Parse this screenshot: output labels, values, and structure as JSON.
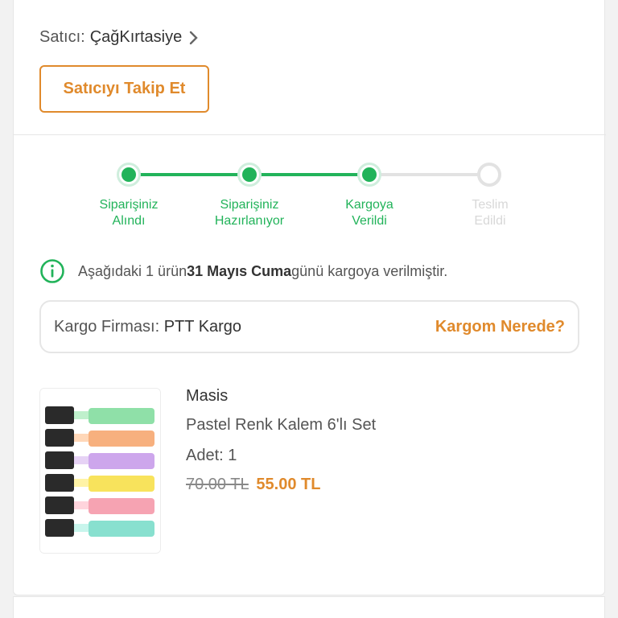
{
  "seller": {
    "prefix": "Satıcı:",
    "name": "ÇağKırtasiye",
    "follow_label": "Satıcıyı Takip Et"
  },
  "stepper": {
    "steps": [
      {
        "line1": "Siparişiniz",
        "line2": "Alındı",
        "status": "done"
      },
      {
        "line1": "Siparişiniz",
        "line2": "Hazırlanıyor",
        "status": "done"
      },
      {
        "line1": "Kargoya",
        "line2": "Verildi",
        "status": "done"
      },
      {
        "line1": "Teslim",
        "line2": "Edildi",
        "status": "pending"
      }
    ],
    "colors": {
      "done": "#22b35a",
      "pending": "#e2e2e2"
    }
  },
  "info": {
    "icon": "info-circle-icon",
    "before": "Aşağıdaki 1 ürün ",
    "date": "31 Mayıs Cuma",
    "after": " günü kargoya verilmiştir."
  },
  "cargo": {
    "label": "Kargo Firması:",
    "company": "PTT Kargo",
    "link": "Kargom Nerede?"
  },
  "product": {
    "brand": "Masis",
    "name": "Pastel Renk Kalem 6'lı Set",
    "quantity": "Adet: 1",
    "old_price": "70.00 TL",
    "new_price": "55.00 TL",
    "image": "pastel-highlighter-set-image"
  },
  "colors": {
    "accent": "#e08a2c",
    "success": "#22b35a"
  }
}
